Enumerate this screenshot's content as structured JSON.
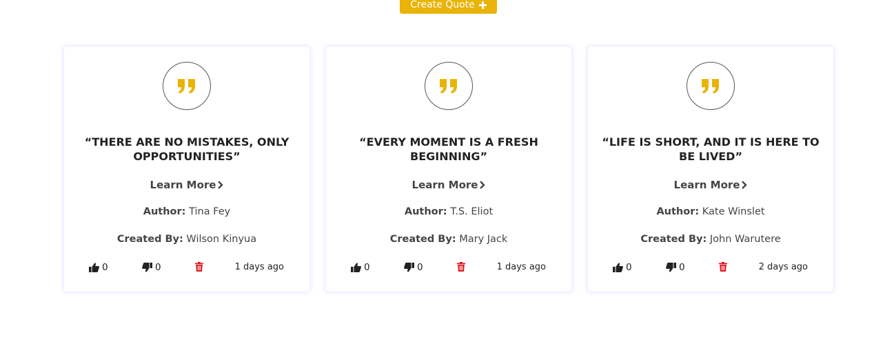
{
  "header": {
    "create_button_label": "Create Quote"
  },
  "colors": {
    "accent": "#e9b308",
    "delete": "#e0141d",
    "card_shadow": "#cbaaff"
  },
  "quotes": [
    {
      "text": "“THERE ARE NO MISTAKES, ONLY OPPORTUNITIES”",
      "learn_more": "Learn More",
      "author_label": "Author:",
      "author": "Tina Fey",
      "created_by_label": "Created By:",
      "created_by": "Wilson Kinyua",
      "likes": "0",
      "dislikes": "0",
      "time_ago": "1 days ago"
    },
    {
      "text": "“EVERY MOMENT IS A FRESH BEGINNING”",
      "learn_more": "Learn More",
      "author_label": "Author:",
      "author": "T.S. Eliot",
      "created_by_label": "Created By:",
      "created_by": "Mary Jack",
      "likes": "0",
      "dislikes": "0",
      "time_ago": "1 days ago"
    },
    {
      "text": "“LIFE IS SHORT, AND IT IS HERE TO BE LIVED”",
      "learn_more": "Learn More",
      "author_label": "Author:",
      "author": "Kate Winslet",
      "created_by_label": "Created By:",
      "created_by": "John Warutere",
      "likes": "0",
      "dislikes": "0",
      "time_ago": "2 days ago"
    }
  ]
}
